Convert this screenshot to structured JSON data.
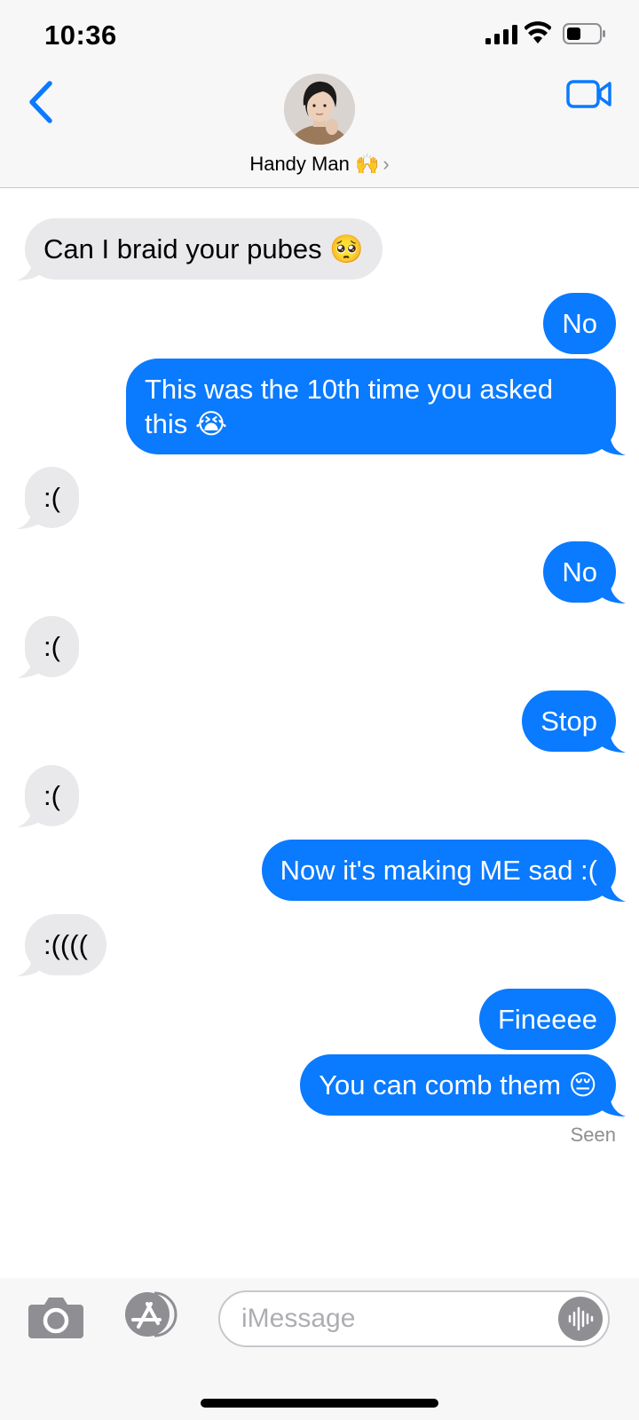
{
  "status_bar": {
    "time": "10:36"
  },
  "header": {
    "contact_name": "Handy Man 🙌",
    "chevron": "›",
    "icons": {
      "back": "chevron-left-icon",
      "video": "video-camera-icon"
    },
    "accent_color": "#0a7aff"
  },
  "messages": [
    {
      "direction": "incoming",
      "text": "Can I braid your pubes 🥺"
    },
    {
      "direction": "outgoing",
      "text": "No"
    },
    {
      "direction": "outgoing",
      "text": "This was the 10th time you asked this 😭"
    },
    {
      "direction": "incoming",
      "text": ":("
    },
    {
      "direction": "outgoing",
      "text": "No"
    },
    {
      "direction": "incoming",
      "text": ":("
    },
    {
      "direction": "outgoing",
      "text": "Stop"
    },
    {
      "direction": "incoming",
      "text": ":("
    },
    {
      "direction": "outgoing",
      "text": "Now it's making ME sad :("
    },
    {
      "direction": "incoming",
      "text": ":(((("
    },
    {
      "direction": "outgoing",
      "text": "Fineeee"
    },
    {
      "direction": "outgoing",
      "text": "You can comb them 😔"
    }
  ],
  "seen_label": "Seen",
  "composer": {
    "placeholder": "iMessage",
    "icons": {
      "camera": "camera-icon",
      "apps": "app-store-icon",
      "dictation": "audio-waveform-icon"
    }
  },
  "colors": {
    "outgoing_bubble": "#0a7aff",
    "incoming_bubble": "#e9e9eb"
  }
}
